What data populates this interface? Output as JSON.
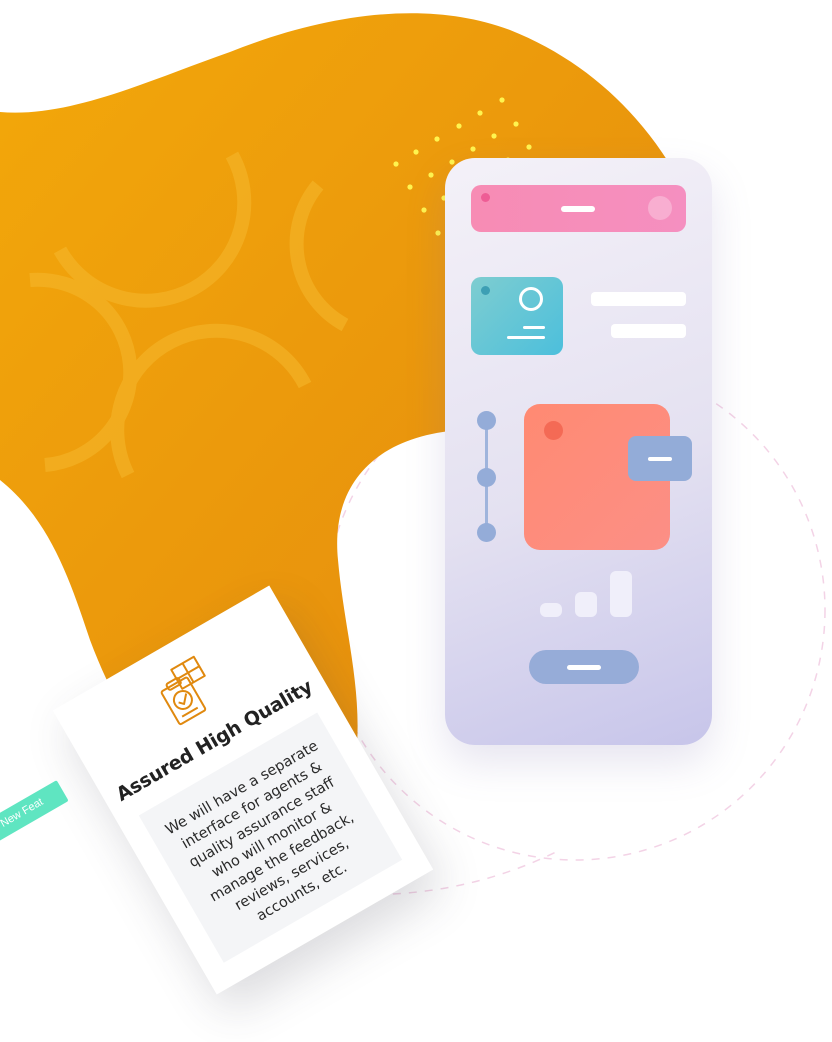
{
  "colors": {
    "blob_start": "#f2a609",
    "blob_end": "#e5890f",
    "phone_header": "#f78cb4",
    "profile_card": "#56c3da",
    "big_card": "#ff8a72",
    "accent_blue": "#94acd8",
    "ribbon": "#5fe5c1",
    "dots": "#ffff66"
  },
  "feature_card": {
    "icon": "quality-checklist-icon",
    "title": "Assured High Quality",
    "description": "We will have a separate interface for agents & quality assurance staff who will monitor & manage the feedback, reviews, services, accounts, etc."
  },
  "ribbon": {
    "label": "New Feat"
  },
  "phone": {
    "signal_levels": [
      0.3,
      0.55,
      1.0
    ]
  }
}
